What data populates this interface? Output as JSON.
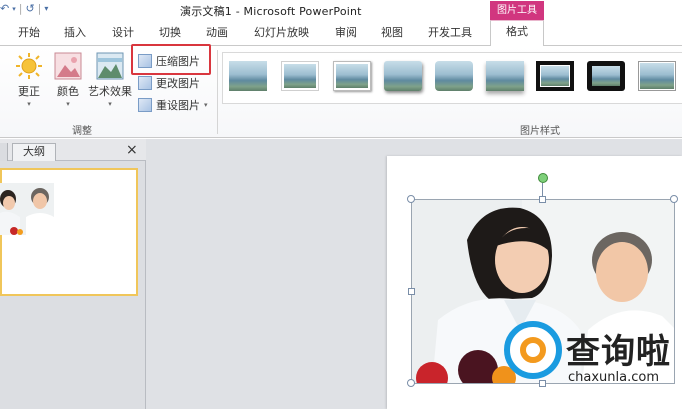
{
  "quick_access": {
    "undo": "↶",
    "redo": "↺"
  },
  "title": "演示文稿1  -  Microsoft PowerPoint",
  "picture_tools_label": "图片工具",
  "tabs": [
    {
      "label": "开始"
    },
    {
      "label": "插入"
    },
    {
      "label": "设计"
    },
    {
      "label": "切换"
    },
    {
      "label": "动画"
    },
    {
      "label": "幻灯片放映"
    },
    {
      "label": "审阅"
    },
    {
      "label": "视图"
    },
    {
      "label": "开发工具"
    }
  ],
  "format_tab": "格式",
  "ribbon": {
    "corrections": "更正",
    "color": "颜色",
    "artistic_effects": "艺术效果",
    "compress": "压缩图片",
    "change": "更改图片",
    "reset": "重设图片",
    "adjust_group": "调整",
    "styles_group": "图片样式"
  },
  "pane": {
    "outline_tab": "大纲",
    "close": "×"
  },
  "watermark": {
    "text": "查询啦",
    "url": "chaxunla.com"
  },
  "colors": {
    "accent_pink": "#d1367f",
    "highlight_red": "#d9363e",
    "selection_yellow": "#f0c65a"
  }
}
